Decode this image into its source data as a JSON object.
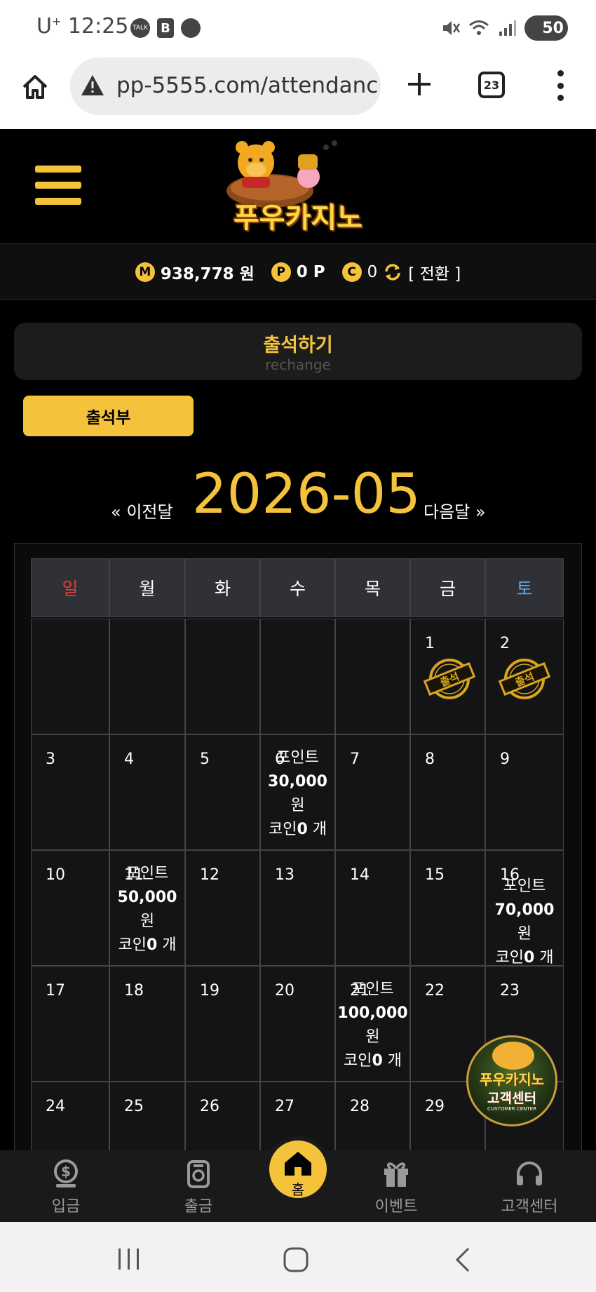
{
  "status": {
    "carrier": "U",
    "carrier_sup": "+",
    "time": "12:25",
    "icons": [
      "talk-icon",
      "b-icon",
      "chat-icon",
      "mute-icon",
      "wifi-icon",
      "signal-icon"
    ],
    "battery": "50",
    "talk_label": "TALK",
    "b_label": "B"
  },
  "browser": {
    "url": "pp-5555.com/attendanc",
    "tab_count": "23"
  },
  "site": {
    "logo_text": "푸우카지노"
  },
  "wallet": {
    "money_icon": "M",
    "money": "938,778 원",
    "point_icon": "P",
    "points": "0 P",
    "coin_icon": "C",
    "coins": "0",
    "exchange": "[ 전환 ]"
  },
  "attendance": {
    "title": "출석하기",
    "subtitle": "rechange",
    "book_button": "출석부"
  },
  "calendar": {
    "prev": "« 이전달",
    "month": "2026-05",
    "next": "다음달 »",
    "weekdays": [
      "일",
      "월",
      "화",
      "수",
      "목",
      "금",
      "토"
    ],
    "stamp_label": "출석",
    "weeks": [
      [
        {
          "day": "",
          "stamp": false
        },
        {
          "day": "",
          "stamp": false
        },
        {
          "day": "",
          "stamp": false
        },
        {
          "day": "",
          "stamp": false
        },
        {
          "day": "",
          "stamp": false
        },
        {
          "day": "1",
          "stamp": true
        },
        {
          "day": "2",
          "stamp": true
        }
      ],
      [
        {
          "day": "3"
        },
        {
          "day": "4"
        },
        {
          "day": "5"
        },
        {
          "day": "6",
          "reward": {
            "l1": "포인트",
            "l2": "30,000",
            "l3": "원",
            "l4a": "코인",
            "l4b": "0",
            "l4c": " 개"
          }
        },
        {
          "day": "7"
        },
        {
          "day": "8"
        },
        {
          "day": "9"
        }
      ],
      [
        {
          "day": "10"
        },
        {
          "day": "11",
          "reward": {
            "l1": "포인트",
            "l2": "50,000",
            "l3": "원",
            "l4a": "코인",
            "l4b": "0",
            "l4c": " 개"
          }
        },
        {
          "day": "12"
        },
        {
          "day": "13"
        },
        {
          "day": "14"
        },
        {
          "day": "15"
        },
        {
          "day": "16",
          "reward": {
            "l1": "포인트",
            "l2": "70,000",
            "l3": " 원",
            "l4a": "코인",
            "l4b": "0",
            "l4c": " 개"
          }
        }
      ],
      [
        {
          "day": "17"
        },
        {
          "day": "18"
        },
        {
          "day": "19"
        },
        {
          "day": "20"
        },
        {
          "day": "21",
          "reward": {
            "l1": "포인트",
            "l2": "100,000",
            "l3": "원",
            "l4a": "코인",
            "l4b": "0",
            "l4c": " 개"
          }
        },
        {
          "day": "22"
        },
        {
          "day": "23"
        }
      ],
      [
        {
          "day": "24"
        },
        {
          "day": "25"
        },
        {
          "day": "26"
        },
        {
          "day": "27"
        },
        {
          "day": "28"
        },
        {
          "day": "29"
        },
        {
          "day": ""
        }
      ]
    ]
  },
  "cs_float": {
    "name": "푸우카지노",
    "sub": "고객센터",
    "en": "CUSTOMER CENTER"
  },
  "bottom_nav": {
    "deposit": "입금",
    "withdraw": "출금",
    "home": "홈",
    "event": "이벤트",
    "support": "고객센터"
  },
  "colors": {
    "accent": "#f5c33b",
    "sunday": "#e53935",
    "saturday": "#5da9f0"
  }
}
